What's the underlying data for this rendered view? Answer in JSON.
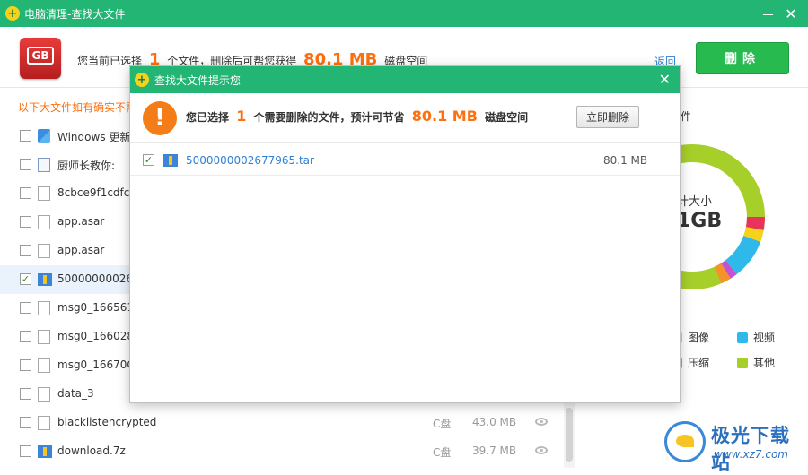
{
  "window": {
    "title": "电脑清理-查找大文件",
    "minimize_icon": "minimize-icon",
    "close_icon": "close-icon"
  },
  "summary": {
    "prefix": "您当前已选择",
    "count": "1",
    "middle": "个文件，删除后可帮您获得",
    "size": "80.1 MB",
    "suffix": "磁盘空间",
    "back_label": "返回",
    "delete_label": "删除"
  },
  "hint": "以下大文件如有确实不需要",
  "files": [
    {
      "name": "Windows 更新",
      "icon": "windows-icon",
      "checked": false,
      "drive": "",
      "size": ""
    },
    {
      "name": "厨师长教你:",
      "icon": "document-icon",
      "checked": false,
      "drive": "",
      "size": ""
    },
    {
      "name": "8cbce9f1cdfcc",
      "icon": "file-icon",
      "checked": false,
      "drive": "",
      "size": ""
    },
    {
      "name": "app.asar",
      "icon": "file-icon",
      "checked": false,
      "drive": "",
      "size": ""
    },
    {
      "name": "app.asar",
      "icon": "file-icon",
      "checked": false,
      "drive": "",
      "size": ""
    },
    {
      "name": "500000000267",
      "icon": "archive-icon",
      "checked": true,
      "drive": "",
      "size": ""
    },
    {
      "name": "msg0_166561",
      "icon": "file-icon",
      "checked": false,
      "drive": "",
      "size": ""
    },
    {
      "name": "msg0_166028",
      "icon": "file-icon",
      "checked": false,
      "drive": "",
      "size": ""
    },
    {
      "name": "msg0_16670C",
      "icon": "file-icon",
      "checked": false,
      "drive": "",
      "size": ""
    },
    {
      "name": "data_3",
      "icon": "file-icon",
      "checked": false,
      "drive": "",
      "size": ""
    },
    {
      "name": "blacklistencrypted",
      "icon": "file-icon",
      "checked": false,
      "drive": "C盘",
      "size": "43.0 MB"
    },
    {
      "name": "download.7z",
      "icon": "archive-icon",
      "checked": false,
      "drive": "C盘",
      "size": "39.7 MB"
    }
  ],
  "right_panel": {
    "label": "件",
    "donut_label": "计大小",
    "donut_value": "1GB",
    "legend": [
      {
        "label": "图像",
        "color": "#f6d21c"
      },
      {
        "label": "视频",
        "color": "#2fb9ea"
      },
      {
        "label": "压缩",
        "color": "#f5922a"
      },
      {
        "label": "其他",
        "color": "#a6cf2a"
      }
    ]
  },
  "modal": {
    "title": "查找大文件提示您",
    "msg_prefix": "您已选择",
    "msg_count": "1",
    "msg_middle": "个需要删除的文件，预计可节省",
    "msg_size": "80.1 MB",
    "msg_suffix": "磁盘空间",
    "button_label": "立即删除",
    "files": [
      {
        "name": "5000000002677965.tar",
        "size": "80.1 MB",
        "checked": true
      }
    ]
  },
  "watermark": {
    "name": "极光下载站",
    "url": "www.xz7.com"
  }
}
